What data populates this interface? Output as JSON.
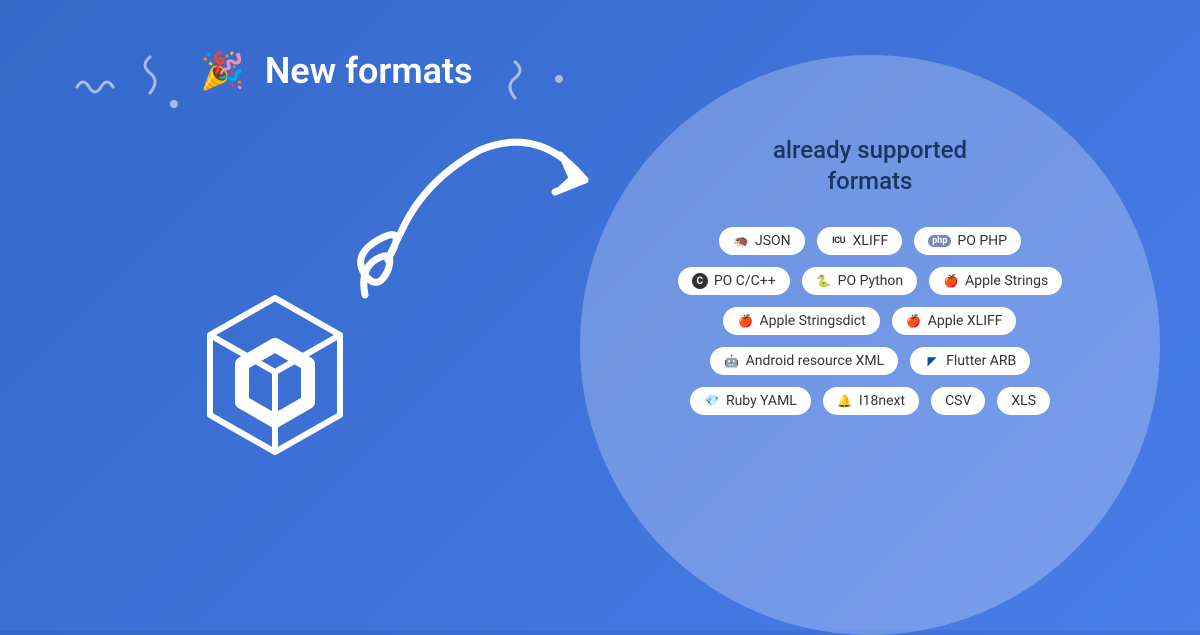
{
  "header": {
    "title": "New formats"
  },
  "circle": {
    "title_line1": "already supported",
    "title_line2": "formats"
  },
  "formats": {
    "row1": [
      "JSON",
      "XLIFF",
      "PO PHP"
    ],
    "row2": [
      "PO C/C++",
      "PO Python",
      "Apple Strings"
    ],
    "row3": [
      "Apple Stringsdict",
      "Apple XLIFF"
    ],
    "row4": [
      "Android resource XML",
      "Flutter ARB"
    ],
    "row5": [
      "Ruby YAML",
      "I18next",
      "CSV",
      "XLS"
    ]
  }
}
